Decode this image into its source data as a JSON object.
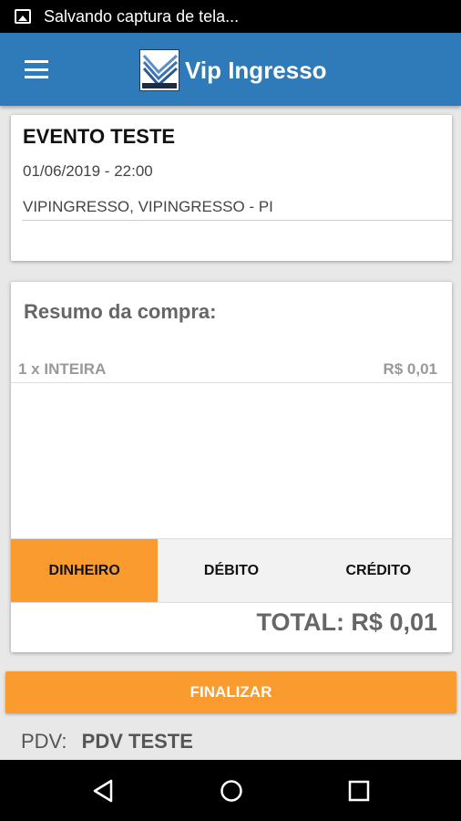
{
  "status_bar": {
    "text": "Salvando captura de tela..."
  },
  "app_bar": {
    "title": "Vip Ingresso"
  },
  "event": {
    "name": "EVENTO TESTE",
    "datetime": "01/06/2019 - 22:00",
    "venue": "VIPINGRESSO, VIPINGRESSO - PI"
  },
  "summary": {
    "title": "Resumo da compra:",
    "items": [
      {
        "description": "1 x INTEIRA",
        "price": "R$ 0,01"
      }
    ],
    "payment_methods": [
      "DINHEIRO",
      "DÉBITO",
      "CRÉDITO"
    ],
    "selected_payment": "DINHEIRO",
    "total": "TOTAL: R$ 0,01"
  },
  "finalize_label": "FINALIZAR",
  "pdv": {
    "label": "PDV:",
    "value": "PDV TESTE"
  },
  "colors": {
    "app_bar": "#2f7ab9",
    "accent": "#f99b2f"
  },
  "icons": {
    "menu": "hamburger-icon",
    "back": "triangle-back-icon",
    "home": "circle-home-icon",
    "recent": "square-recent-icon"
  }
}
